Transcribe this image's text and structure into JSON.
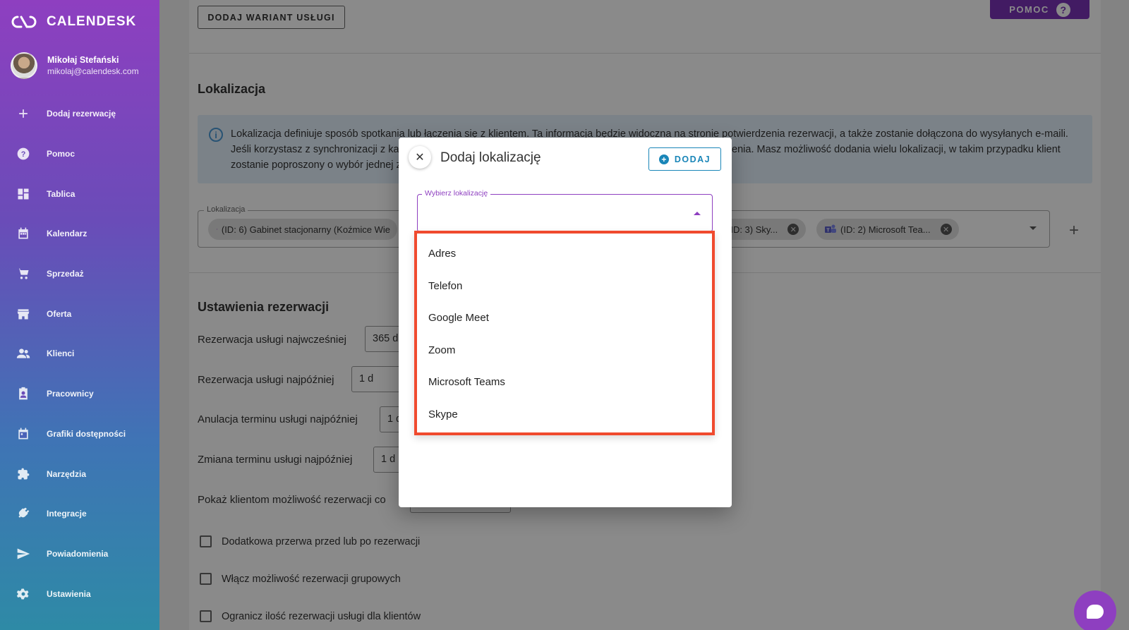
{
  "app": {
    "logo_text": "CALENDESK"
  },
  "user": {
    "name": "Mikołaj Stefański",
    "email": "mikolaj@calendesk.com"
  },
  "sidebar": {
    "items": [
      {
        "label": "Dodaj rezerwację",
        "icon": "plus-icon"
      },
      {
        "label": "Pomoc",
        "icon": "help-icon"
      },
      {
        "label": "Tablica",
        "icon": "dashboard-icon"
      },
      {
        "label": "Kalendarz",
        "icon": "calendar-icon"
      },
      {
        "label": "Sprzedaż",
        "icon": "cart-icon"
      },
      {
        "label": "Oferta",
        "icon": "store-icon"
      },
      {
        "label": "Klienci",
        "icon": "people-icon"
      },
      {
        "label": "Pracownicy",
        "icon": "badge-icon"
      },
      {
        "label": "Grafiki dostępności",
        "icon": "schedule-icon"
      },
      {
        "label": "Narzędzia",
        "icon": "puzzle-icon"
      },
      {
        "label": "Integracje",
        "icon": "plug-icon"
      },
      {
        "label": "Powiadomienia",
        "icon": "send-icon"
      },
      {
        "label": "Ustawienia",
        "icon": "gear-icon"
      }
    ]
  },
  "main": {
    "add_variant_label": "DODAJ WARIANT USŁUGI",
    "help_label": "POMOC",
    "location_section": {
      "title": "Lokalizacja",
      "info_text": "Lokalizacja definiuje sposób spotkania lub łączenia się z klientem. Ta informacja będzie widoczna na stronie potwierdzenia rezerwacji, a także zostanie dołączona do wysyłanych e-maili. Jeśli korzystasz z synchronizacji z kalendarzami zewnętrznymi, lokalizacja zostanie dodana do danego wydarzenia. Masz możliwość dodania wielu lokalizacji, w takim przypadku klient zostanie poproszony o wybór jednej z nich.",
      "field_label": "Lokalizacja",
      "chips": [
        {
          "label": "(ID: 6) Gabinet stacjonarny (Koźmice Wie"
        },
        {
          "label": "(ID: 3) Sky..."
        },
        {
          "label": "(ID: 2) Microsoft Tea..."
        }
      ]
    },
    "booking_section": {
      "title": "Ustawienia rezerwacji",
      "rows": [
        {
          "label": "Rezerwacja usługi najwcześniej",
          "value": "365 d"
        },
        {
          "label": "Rezerwacja usługi najpóźniej",
          "value": "1 d"
        },
        {
          "label": "Anulacja terminu usługi najpóźniej",
          "value": "1 d"
        },
        {
          "label": "Zmiana terminu usługi najpóźniej",
          "value": "1 d"
        },
        {
          "label": "Pokaż klientom możliwość rezerwacji co",
          "value": ""
        }
      ],
      "checkboxes": [
        {
          "label": "Dodatkowa przerwa przed lub po rezerwacji"
        },
        {
          "label": "Włącz możliwość rezerwacji grupowych"
        },
        {
          "label": "Ogranicz ilość rezerwacji usługi dla klientów"
        }
      ]
    }
  },
  "dialog": {
    "title": "Dodaj lokalizację",
    "add_label": "DODAJ",
    "select_label": "Wybierz lokalizację",
    "options": [
      "Adres",
      "Telefon",
      "Google Meet",
      "Zoom",
      "Microsoft Teams",
      "Skype"
    ]
  },
  "colors": {
    "accent": "#8e3fc0",
    "primary_blue": "#1a86b8",
    "highlight": "#f04a2e"
  }
}
